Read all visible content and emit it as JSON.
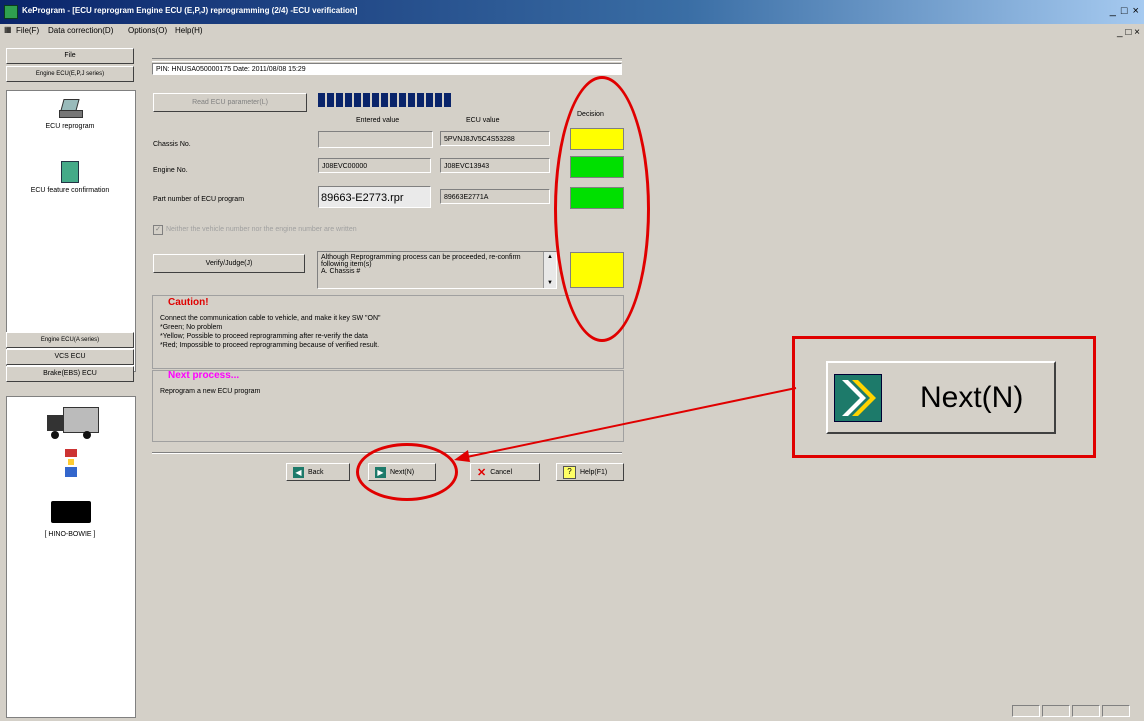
{
  "window": {
    "title": "KeProgram - [ECU reprogram Engine ECU (E,P,J) reprogramming (2/4) -ECU verification]",
    "controls": "_ □ ×",
    "mdi_controls": "_ □ ×"
  },
  "menu": [
    "File(F)",
    "Data correction(D)",
    "Options(O)",
    "Help(H)"
  ],
  "sidebar": {
    "top_buttons": [
      "File",
      "Engine ECU(E,P,J series)"
    ],
    "tools": [
      "ECU reprogram",
      "ECU feature confirmation"
    ],
    "bottom_buttons": [
      "Engine ECU(A series)",
      "VCS ECU",
      "Brake(EBS) ECU"
    ],
    "vehicle_label": "[ HINO-BOWIE ]"
  },
  "header": {
    "info": "PIN: HNUSA050000175  Date: 2011/08/08 15:29"
  },
  "read_button": "Read ECU parameter(L)",
  "progress": {
    "segments": 15,
    "filled": 15
  },
  "table": {
    "col_entered": "Entered value",
    "col_ecu": "ECU value",
    "col_decision": "Decision",
    "rows": [
      {
        "label": "Chassis No.",
        "entered": "",
        "ecu": "5PVNJ8JV5C4S53288",
        "decision": "yellow",
        "decision_color": "#ffff00"
      },
      {
        "label": "Engine No.",
        "entered": "J08EVC00000",
        "ecu": "J08EVC13943",
        "decision": "green",
        "decision_color": "#00e000"
      },
      {
        "label": "Part number of ECU program",
        "entered": "89663-E2773.rpr",
        "ecu": "89663E2771A",
        "decision": "green",
        "decision_color": "#00e000"
      }
    ]
  },
  "checkbox_text": "Neither the vehicle number nor the engine number are written",
  "verify_button": "Verify/Judge(J)",
  "verify_message": "Although Reprogramming process can be proceeded, re-confirm following item(s)\nA. Chassis #",
  "verify_decision_color": "#ffff00",
  "caution": {
    "title": "Caution!",
    "lines": [
      "Connect the communication cable to vehicle, and make it key SW \"ON\"",
      "*Green; No problem",
      "*Yellow; Possible to proceed reprogramming after re-verify the data",
      "*Red; Impossible to proceed reprogramming because of verified result."
    ]
  },
  "next_process": {
    "title": "Next process...",
    "text": "Reprogram a new ECU program"
  },
  "buttons": {
    "back": "Back",
    "next": "Next(N)",
    "cancel": "Cancel",
    "help": "Help(F1)"
  },
  "zoom_callout": {
    "label": "Next(N)"
  },
  "colors": {
    "annotation": "#e00000",
    "title_bar": "#0a246a",
    "caution": "#e00000",
    "next_process": "#ff00ff"
  }
}
